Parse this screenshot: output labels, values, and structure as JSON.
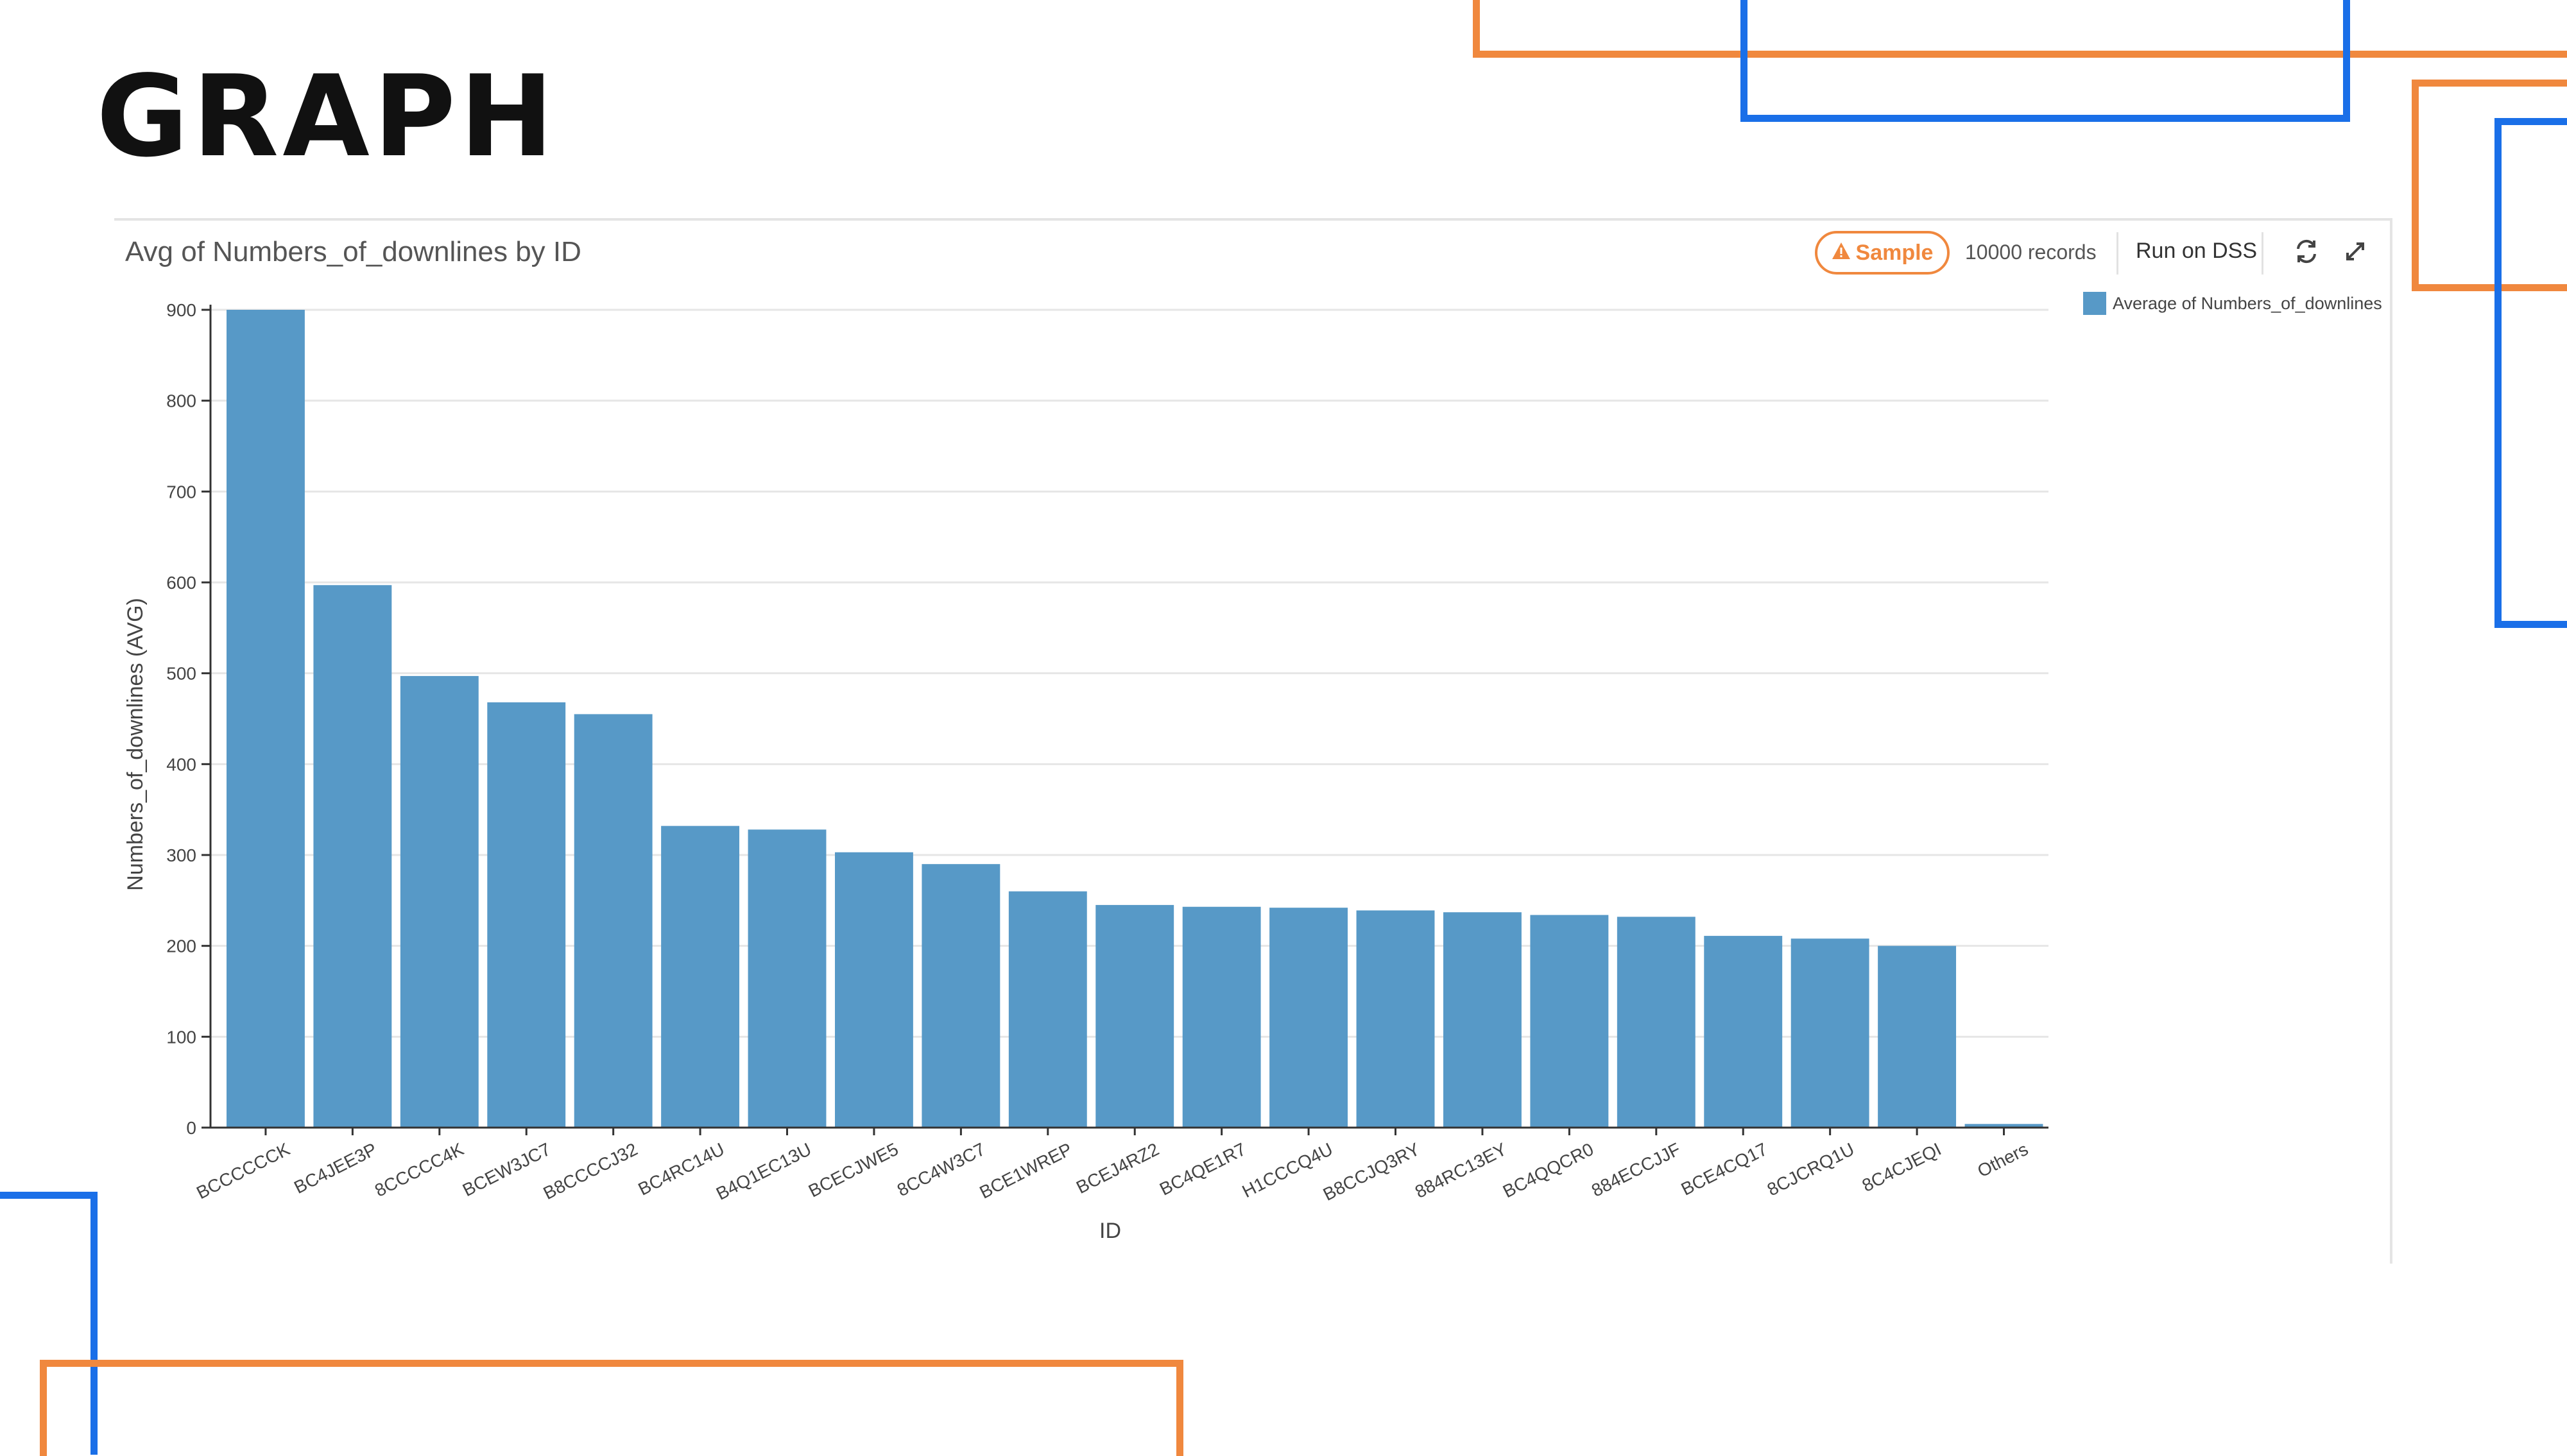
{
  "slide": {
    "title": "GRAPH"
  },
  "toolbar": {
    "chart_title": "Avg of Numbers_of_downlines by ID",
    "sample_label": "Sample",
    "records_label": "10000 records",
    "run_label": "Run on DSS",
    "refresh_icon": "refresh-icon",
    "expand_icon": "expand-icon",
    "warning_icon": "warning-icon"
  },
  "colors": {
    "bar": "#5799c7",
    "accent_orange": "#f0883e",
    "accent_blue": "#1a6fe8",
    "grid": "#e6e6e6"
  },
  "chart_data": {
    "type": "bar",
    "title": "Avg of Numbers_of_downlines by ID",
    "xlabel": "ID",
    "ylabel": "Numbers_of_downlines (AVG)",
    "ylim": [
      0,
      900
    ],
    "yticks": [
      0,
      100,
      200,
      300,
      400,
      500,
      600,
      700,
      800,
      900
    ],
    "grid": true,
    "legend_position": "top-right",
    "categories": [
      "BCCCCCCK",
      "BC4JEE3P",
      "8CCCCC4K",
      "BCEW3JC7",
      "B8CCCCJ32",
      "BC4RC14U",
      "B4Q1EC13U",
      "BCECJWE5",
      "8CC4W3C7",
      "BCE1WREP",
      "BCEJ4RZ2",
      "BC4QE1R7",
      "H1CCCQ4U",
      "B8CCJQ3RY",
      "884RC13EY",
      "BC4QQCR0",
      "884ECCJJF",
      "BCE4CQ17",
      "8CJCRQ1U",
      "8C4CJEQI",
      "Others"
    ],
    "series": [
      {
        "name": "Average of Numbers_of_downlines",
        "values": [
          900,
          597,
          497,
          468,
          455,
          332,
          328,
          303,
          290,
          260,
          245,
          243,
          242,
          239,
          237,
          234,
          232,
          211,
          208,
          200,
          4
        ]
      }
    ]
  }
}
